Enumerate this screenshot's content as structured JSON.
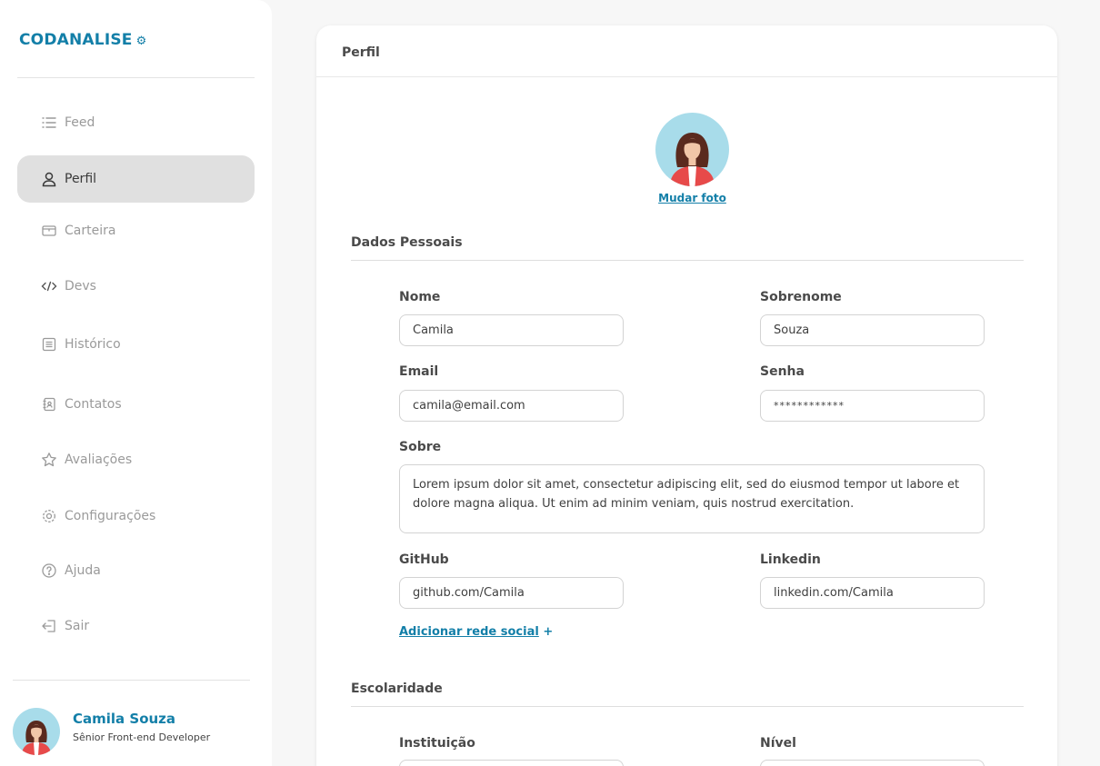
{
  "brand": {
    "name": "CODANALISE",
    "icon": "robot-icon"
  },
  "nav": [
    {
      "label": "Feed",
      "icon": "list-icon",
      "active": false
    },
    {
      "label": "Perfil",
      "icon": "user-icon",
      "active": true
    },
    {
      "label": "Carteira",
      "icon": "wallet-icon",
      "active": false
    },
    {
      "label": "Devs",
      "icon": "code-icon",
      "active": false
    },
    {
      "label": "Histórico",
      "icon": "document-icon",
      "active": false
    },
    {
      "label": "Contatos",
      "icon": "contacts-icon",
      "active": false
    },
    {
      "label": "Avaliações",
      "icon": "star-icon",
      "active": false
    },
    {
      "label": "Configurações",
      "icon": "gear-icon",
      "active": false
    },
    {
      "label": "Ajuda",
      "icon": "help-icon",
      "active": false
    },
    {
      "label": "Sair",
      "icon": "logout-icon",
      "active": false
    }
  ],
  "user": {
    "name": "Camila Souza",
    "role": "Sênior Front-end Developer"
  },
  "card": {
    "title": "Perfil",
    "change_photo": "Mudar foto"
  },
  "personal": {
    "title": "Dados Pessoais",
    "first_name_label": "Nome",
    "first_name": "Camila",
    "last_name_label": "Sobrenome",
    "last_name": "Souza",
    "email_label": "Email",
    "email": "camila@email.com",
    "password_label": "Senha",
    "password": "************",
    "about_label": "Sobre",
    "about": "Lorem ipsum dolor sit amet, consectetur adipiscing elit, sed do eiusmod tempor ut labore et dolore magna aliqua. Ut enim ad minim veniam, quis nostrud exercitation.",
    "github_label": "GitHub",
    "github": "github.com/Camila",
    "linkedin_label": "Linkedin",
    "linkedin": "linkedin.com/Camila",
    "add_social": "Adicionar rede social",
    "add_social_plus": "+"
  },
  "education": {
    "title": "Escolaridade",
    "institution_label": "Instituição",
    "level_label": "Nível"
  },
  "colors": {
    "accent": "#137fa8",
    "active_bg": "#e0e0e0",
    "avatar_bg": "#a8dcea"
  }
}
